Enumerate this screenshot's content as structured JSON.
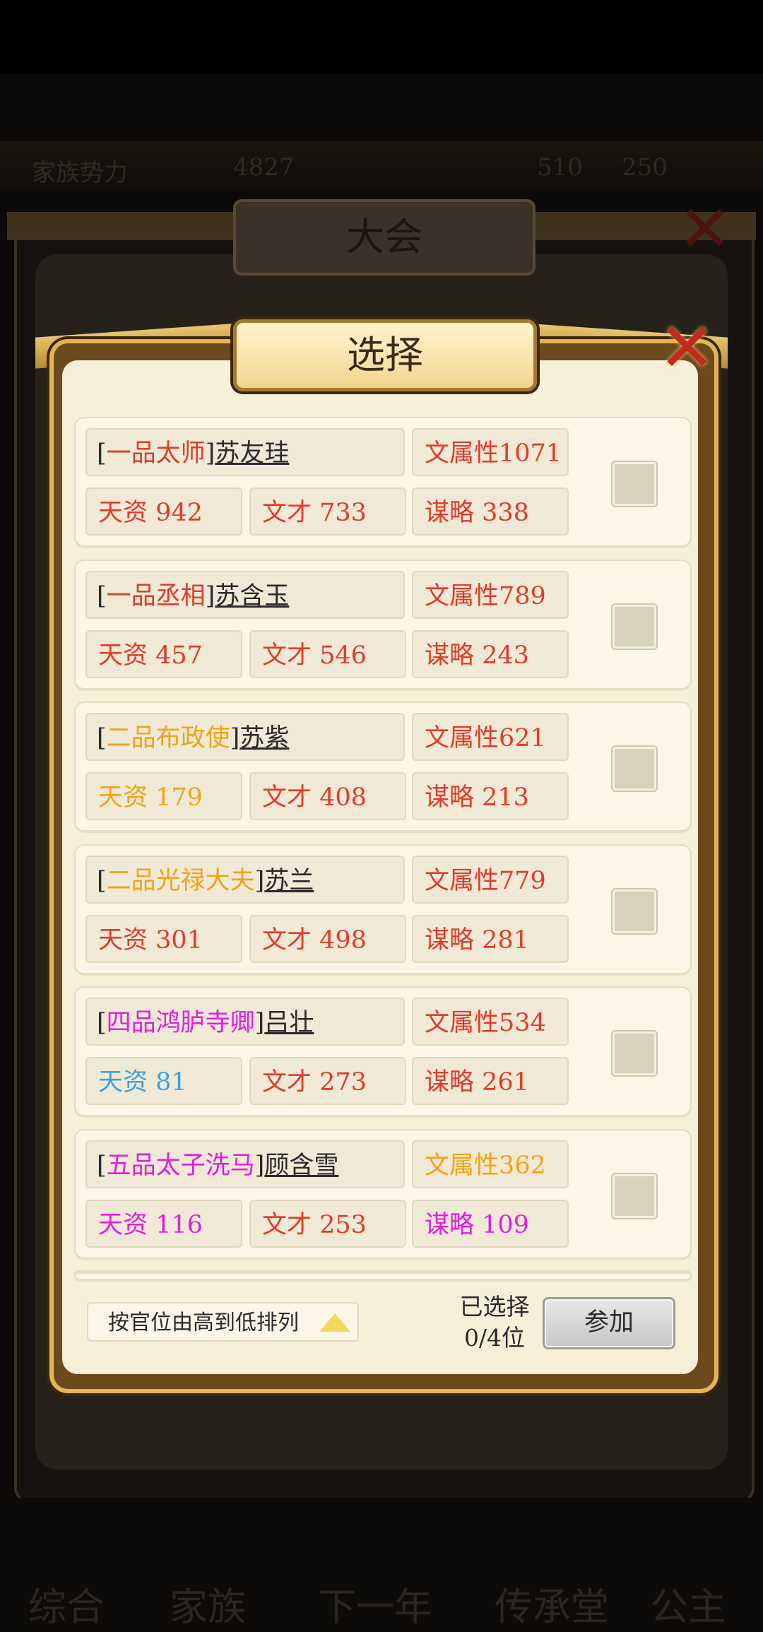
{
  "background": {
    "back_title": "大会",
    "status_left": "家族势力",
    "status_value": "4827",
    "status_right_1": "510",
    "status_right_2": "250",
    "bottom_tabs": [
      "综合",
      "家族",
      "下一年",
      "传承堂",
      "公主"
    ]
  },
  "dialog": {
    "title": "选择",
    "sort_label": "按官位由高到低排列",
    "selected_label": "已选择",
    "selected_count": "0/4位",
    "join_label": "参加"
  },
  "colors": {
    "red": "#e23b2b",
    "orange": "#f2a316",
    "magenta": "#e21ee0",
    "blue": "#3aa0e0",
    "black": "#2a2a2a"
  },
  "candidates": [
    {
      "rank": "一品太师",
      "name": "苏友珪",
      "attr": "文属性1071",
      "tianzi": "天资 942",
      "wencai": "文才 733",
      "moulue": "谋略 338",
      "rank_color": "red",
      "attr_color": "red",
      "tianzi_color": "red",
      "wencai_color": "red",
      "moulue_color": "red"
    },
    {
      "rank": "一品丞相",
      "name": "苏含玉",
      "attr": "文属性789",
      "tianzi": "天资 457",
      "wencai": "文才 546",
      "moulue": "谋略 243",
      "rank_color": "red",
      "attr_color": "red",
      "tianzi_color": "red",
      "wencai_color": "red",
      "moulue_color": "red"
    },
    {
      "rank": "二品布政使",
      "name": "苏紫",
      "attr": "文属性621",
      "tianzi": "天资 179",
      "wencai": "文才 408",
      "moulue": "谋略 213",
      "rank_color": "orange",
      "attr_color": "red",
      "tianzi_color": "orange",
      "wencai_color": "red",
      "moulue_color": "red"
    },
    {
      "rank": "二品光禄大夫",
      "name": "苏兰",
      "attr": "文属性779",
      "tianzi": "天资 301",
      "wencai": "文才 498",
      "moulue": "谋略 281",
      "rank_color": "orange",
      "attr_color": "red",
      "tianzi_color": "red",
      "wencai_color": "red",
      "moulue_color": "red"
    },
    {
      "rank": "四品鸿胪寺卿",
      "name": "吕壮",
      "attr": "文属性534",
      "tianzi": "天资 81",
      "wencai": "文才 273",
      "moulue": "谋略 261",
      "rank_color": "magenta",
      "attr_color": "red",
      "tianzi_color": "blue",
      "wencai_color": "red",
      "moulue_color": "red"
    },
    {
      "rank": "五品太子洗马",
      "name": "顾含雪",
      "attr": "文属性362",
      "tianzi": "天资 116",
      "wencai": "文才 253",
      "moulue": "谋略 109",
      "rank_color": "magenta",
      "attr_color": "orange",
      "tianzi_color": "magenta",
      "wencai_color": "red",
      "moulue_color": "magenta"
    }
  ]
}
